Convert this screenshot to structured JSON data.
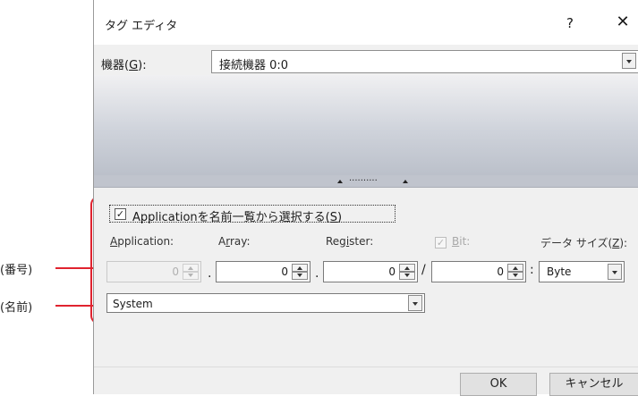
{
  "window": {
    "title": "タグ エディタ",
    "help": "?",
    "close": "✕"
  },
  "device": {
    "label_prefix": "機器(",
    "label_key": "G",
    "label_suffix": "):",
    "value": "接続機器 0:0"
  },
  "splitter": {
    "dots": "▴ ········· ▴"
  },
  "panel": {
    "select_from_list": {
      "checked": true,
      "label_prefix": "Applicationを名前一覧から選択する(",
      "label_key": "S",
      "label_suffix": ")"
    },
    "columns": {
      "application": {
        "prefix": "",
        "key": "A",
        "suffix": "pplication:"
      },
      "array": {
        "prefix": "A",
        "key": "r",
        "suffix": "ray:"
      },
      "register": {
        "prefix": "Reg",
        "key": "i",
        "suffix": "ster:"
      },
      "bit": {
        "prefix": "",
        "key": "B",
        "suffix": "it:"
      },
      "datasize": {
        "prefix": "データ サイズ(",
        "key": "Z",
        "suffix": "):"
      }
    },
    "number_fields": {
      "application": "0",
      "array": "0",
      "register": "0",
      "bit": "0"
    },
    "separators": {
      "dot1": ".",
      "dot2": ".",
      "slash": "/",
      "colon": ":"
    },
    "datasize_value": "Byte",
    "name_value": "System"
  },
  "callouts": {
    "number": "(番号)",
    "name": "(名前)"
  },
  "footer": {
    "ok": "OK",
    "cancel": "キャンセル"
  }
}
